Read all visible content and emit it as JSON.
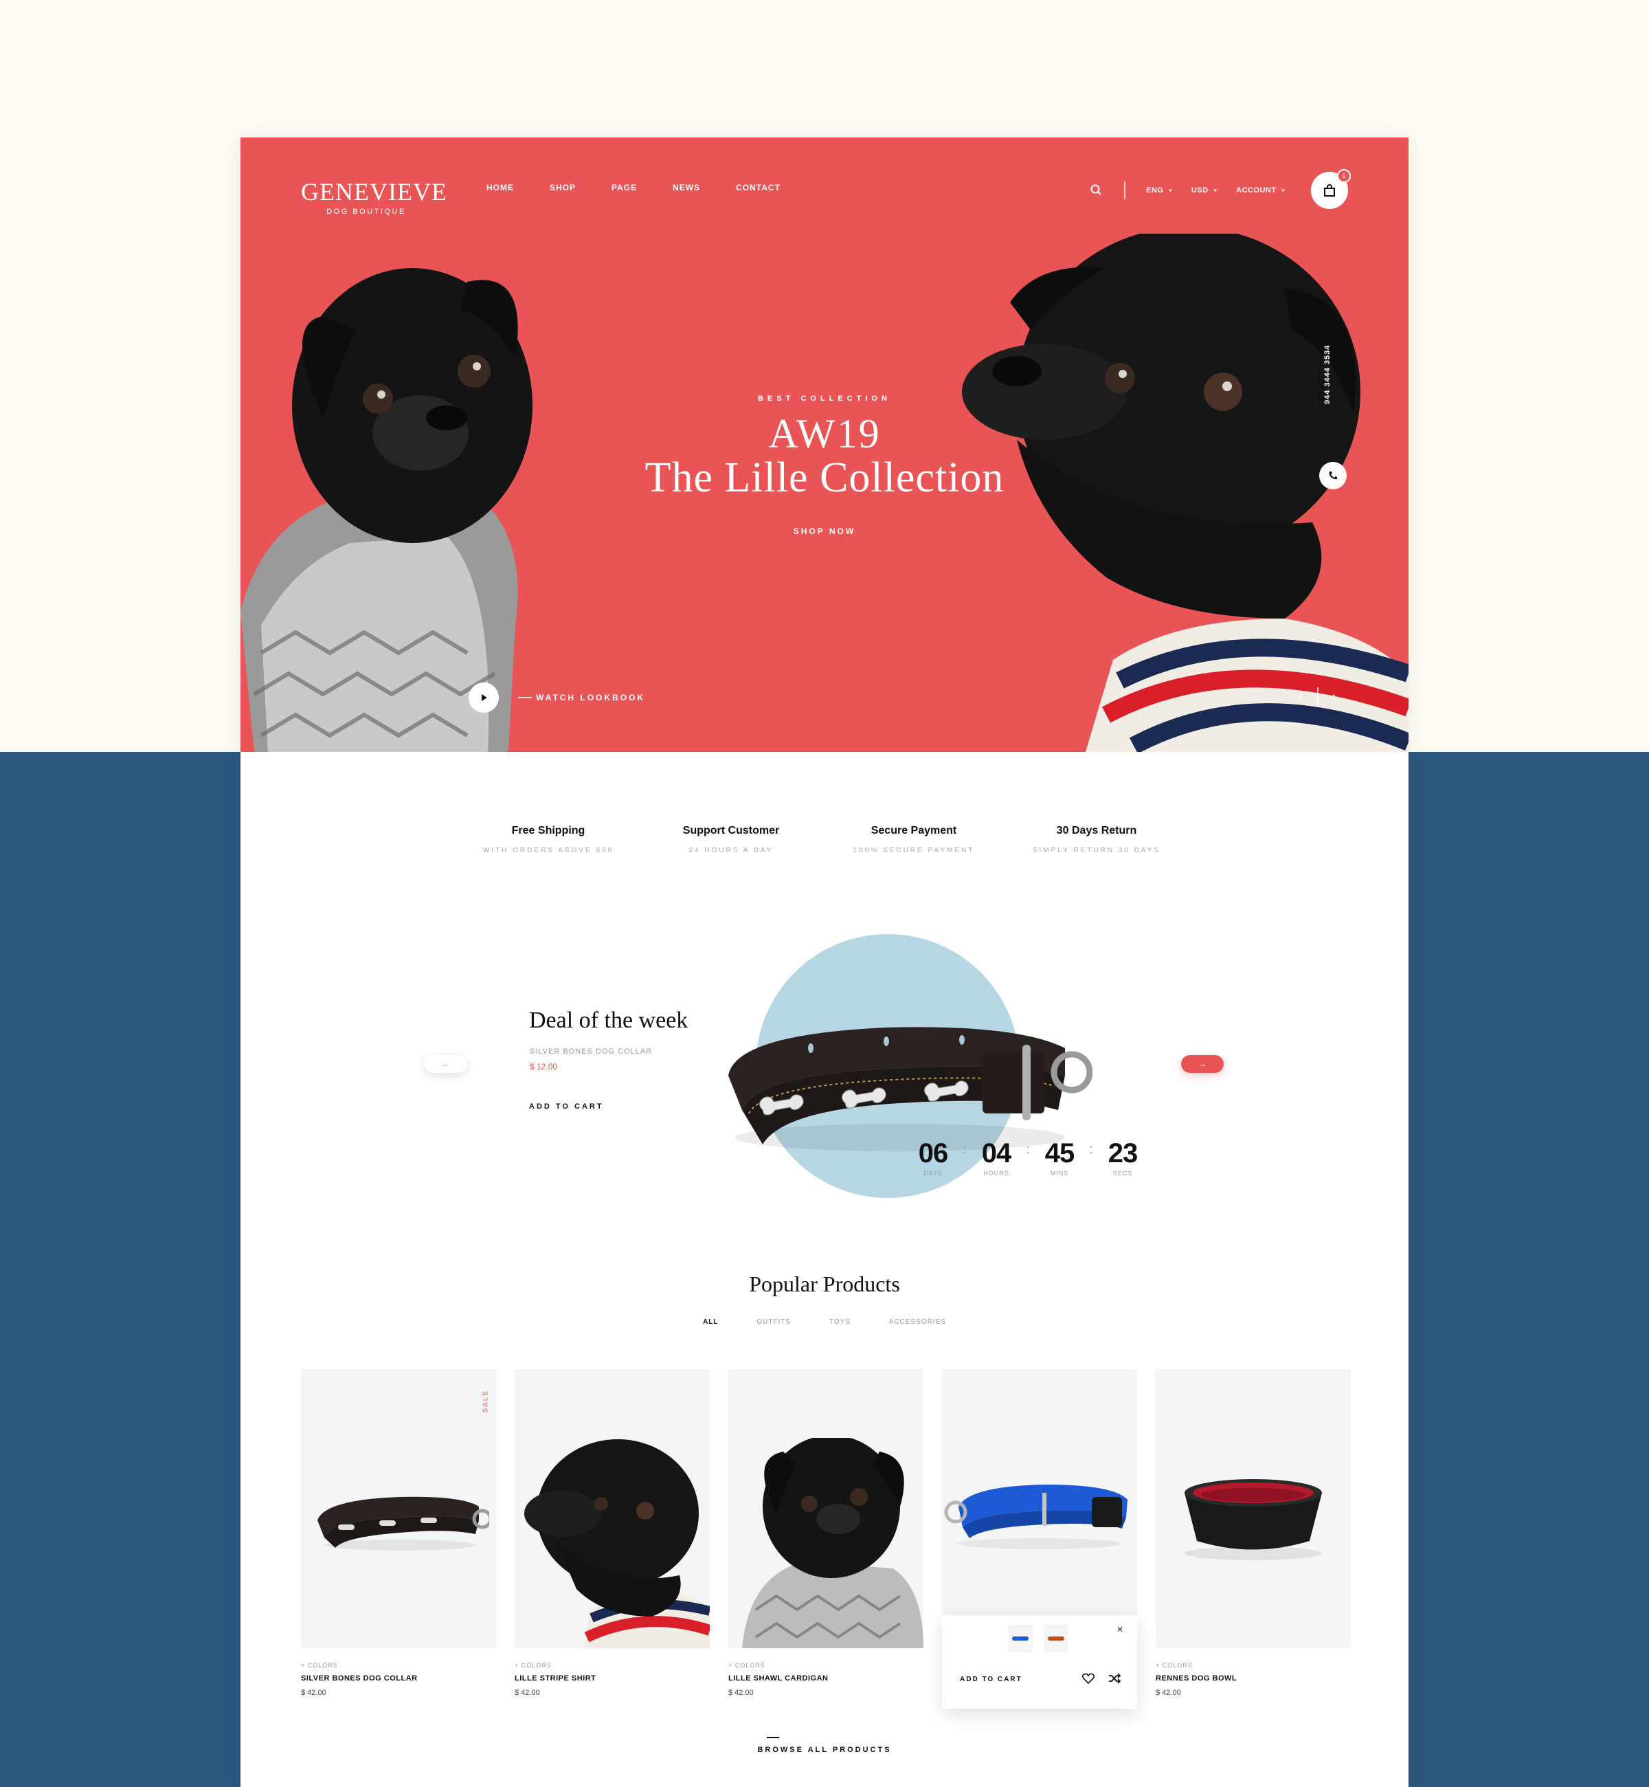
{
  "brand": {
    "name": "GENEVIEVE",
    "tagline": "DOG BOUTIQUE"
  },
  "nav": [
    "HOME",
    "SHOP",
    "PAGE",
    "NEWS",
    "CONTACT"
  ],
  "utility": {
    "language": "ENG",
    "currency": "USD",
    "account": "ACCOUNT",
    "cart_count": "1"
  },
  "hero": {
    "eyebrow": "BEST COLLECTION",
    "title_line1": "AW19",
    "title_line2": "The Lille Collection",
    "cta": "SHOP NOW",
    "phone": "944 3444 3534",
    "lookbook": "WATCH LOOKBOOK"
  },
  "features": [
    {
      "title": "Free Shipping",
      "subtitle": "WITH ORDERS ABOVE $50"
    },
    {
      "title": "Support Customer",
      "subtitle": "24 HOURS A DAY"
    },
    {
      "title": "Secure Payment",
      "subtitle": "100% SECURE PAYMENT"
    },
    {
      "title": "30 Days Return",
      "subtitle": "SIMPLY RETURN 30 DAYS"
    }
  ],
  "deal": {
    "title": "Deal of the week",
    "product": "SILVER BONES DOG COLLAR",
    "price": "$ 12.00",
    "add_to_cart": "ADD TO CART",
    "countdown": [
      {
        "value": "06",
        "label": "DAYS"
      },
      {
        "value": "04",
        "label": "HOURS"
      },
      {
        "value": "45",
        "label": "MINS"
      },
      {
        "value": "23",
        "label": "SECS"
      }
    ]
  },
  "popular": {
    "title": "Popular Products",
    "filters": [
      "ALL",
      "OUTFITS",
      "TOYS",
      "ACCESSORIES"
    ],
    "products": [
      {
        "colors": "+ COLORS",
        "name": "SILVER BONES DOG COLLAR",
        "price": "$ 42.00",
        "badge": "SALE"
      },
      {
        "colors": "+ COLORS",
        "name": "LILLE STRIPE SHIRT",
        "price": "$ 42.00"
      },
      {
        "colors": "+ COLORS",
        "name": "LILLE SHAWL CARDIGAN",
        "price": "$ 42.00"
      },
      {
        "colors": "",
        "name": "",
        "price": "",
        "popup_add": "ADD TO CART"
      },
      {
        "colors": "+ COLORS",
        "name": "RENNES DOG BOWL",
        "price": "$ 42.00"
      }
    ],
    "browse": "BROWSE ALL PRODUCTS"
  },
  "colors": {
    "accent": "#e95556",
    "navy": "#2c5880",
    "cream": "#fefbf2",
    "circle": "#b7d6e4"
  }
}
